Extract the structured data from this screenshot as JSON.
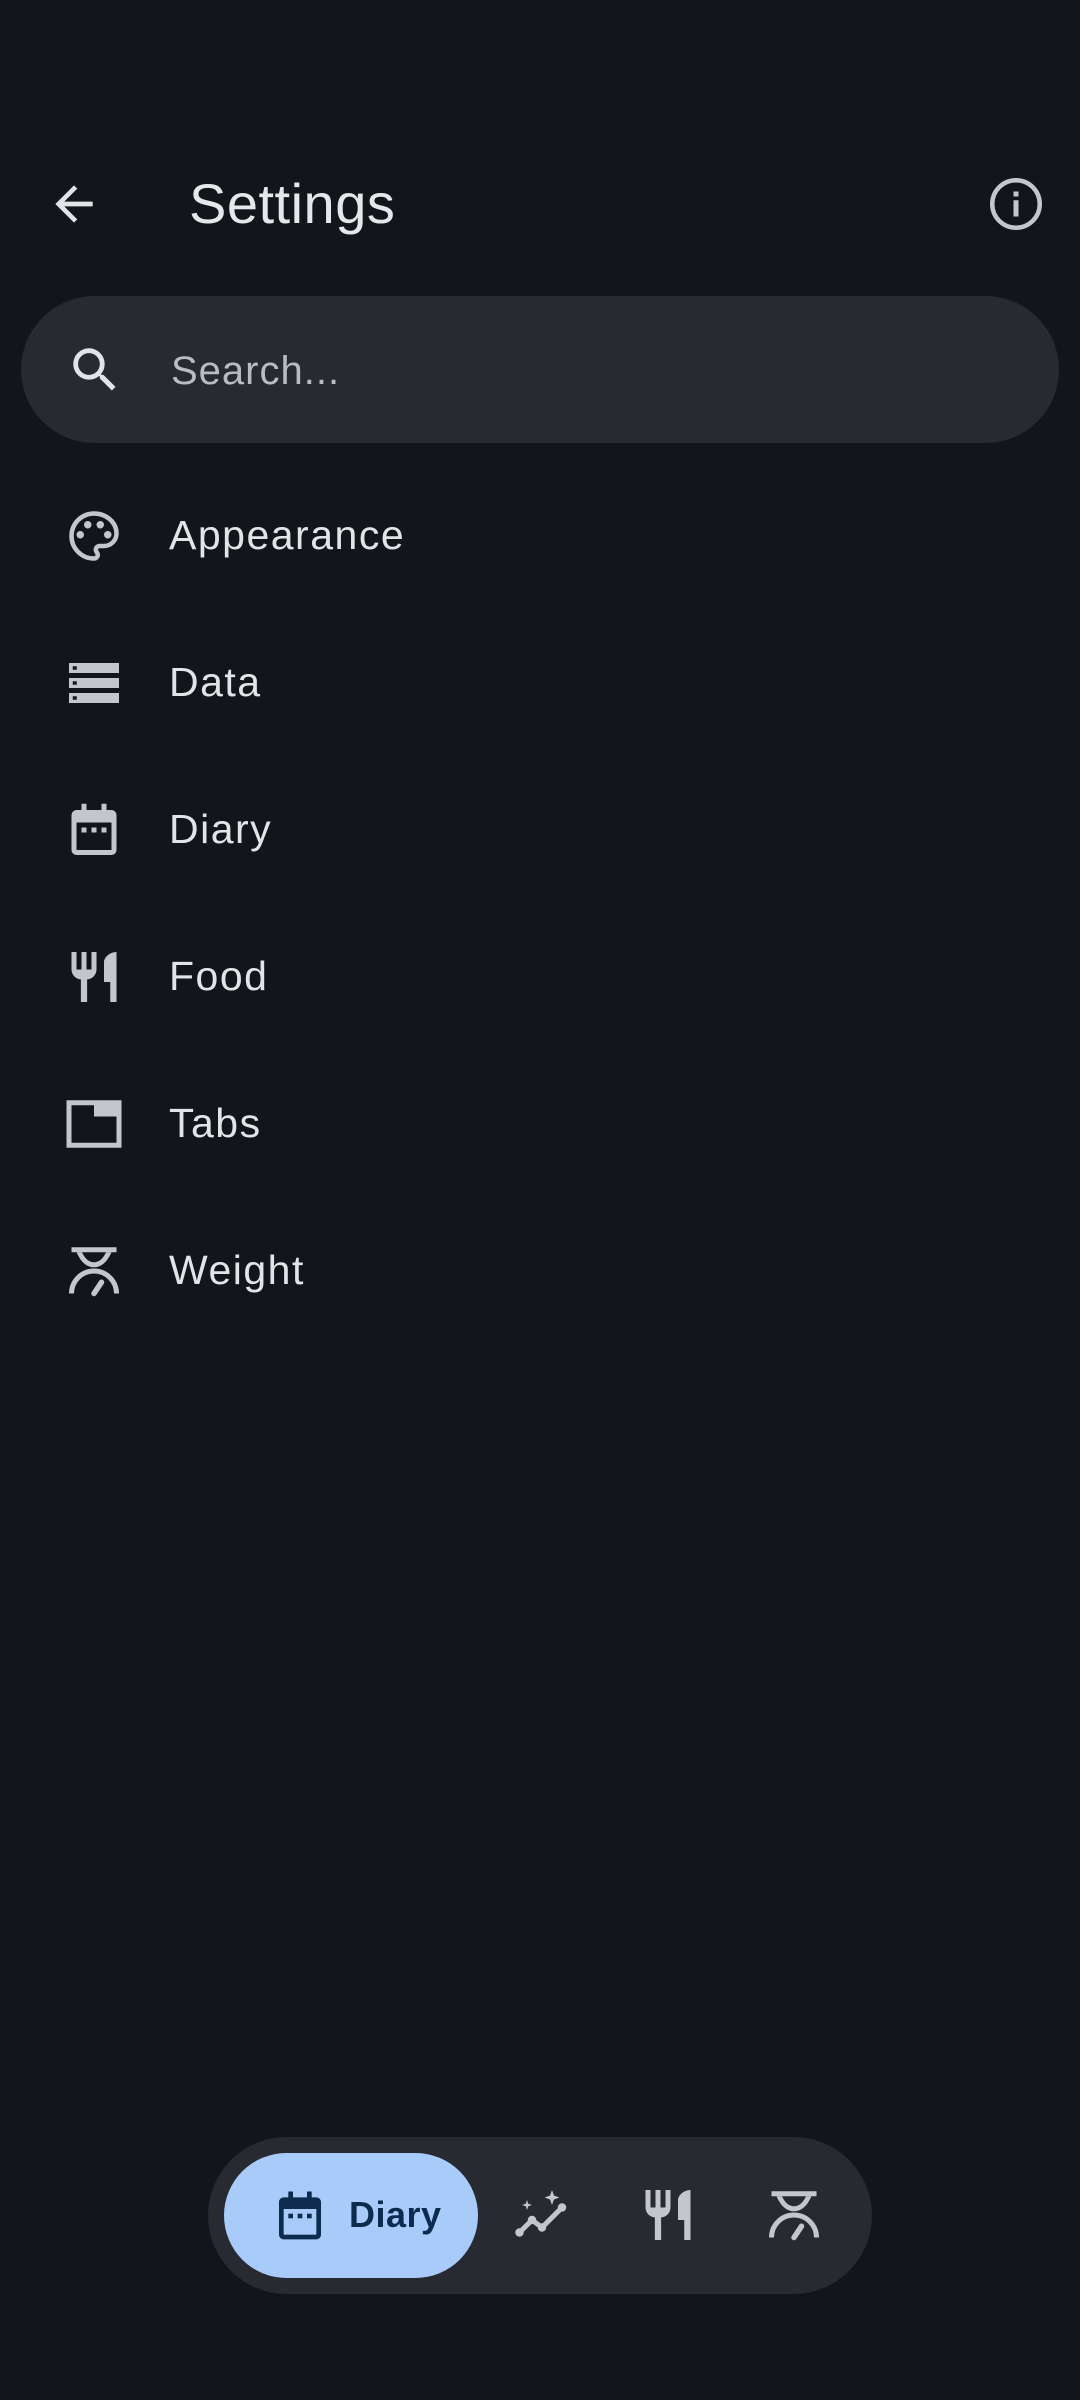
{
  "app_bar": {
    "title": "Settings",
    "back_icon": "arrow-back-icon",
    "info_icon": "info-icon"
  },
  "search": {
    "placeholder": "Search...",
    "value": "",
    "icon": "search-icon"
  },
  "settings": {
    "items": [
      {
        "label": "Appearance",
        "icon": "palette-icon"
      },
      {
        "label": "Data",
        "icon": "storage-icon"
      },
      {
        "label": "Diary",
        "icon": "calendar-icon"
      },
      {
        "label": "Food",
        "icon": "restaurant-icon"
      },
      {
        "label": "Tabs",
        "icon": "tab-icon"
      },
      {
        "label": "Weight",
        "icon": "scale-icon"
      }
    ]
  },
  "bottom_nav": {
    "active": {
      "label": "Diary",
      "icon": "calendar-icon"
    },
    "items": [
      {
        "icon": "trends-icon"
      },
      {
        "icon": "restaurant-icon"
      },
      {
        "icon": "scale-icon"
      }
    ]
  },
  "colors": {
    "background": "#12151a",
    "surface": "#272a30",
    "on_surface": "#e3e4e8",
    "icon": "#c4c6cc",
    "active_pill": "#a8cbfa",
    "on_active_pill": "#0d2b4d"
  }
}
